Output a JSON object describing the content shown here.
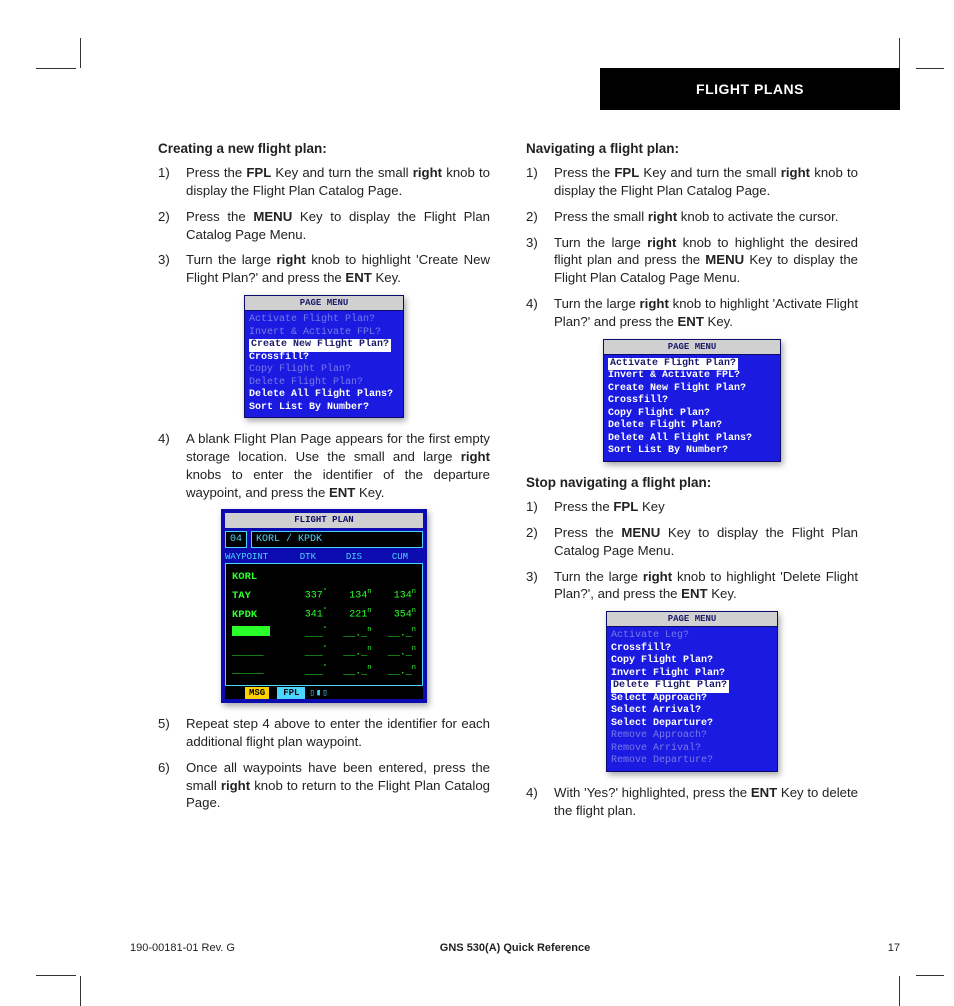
{
  "header": {
    "section": "FLIGHT PLANS"
  },
  "col1": {
    "heading": "Creating a new flight plan:",
    "s1a": "Press the ",
    "s1b": "FPL",
    "s1c": " Key and turn the small ",
    "s1d": "right",
    "s1e": " knob to display the Flight Plan Catalog Page.",
    "s2a": "Press the ",
    "s2b": "MENU",
    "s2c": " Key to display the Flight Plan Catalog Page Menu.",
    "s3a": "Turn the large ",
    "s3b": "right",
    "s3c": " knob to highlight 'Create New Flight Plan?' and press the ",
    "s3d": "ENT",
    "s3e": " Key.",
    "s4a": "A blank Flight Plan Page appears for the first empty storage location.  Use the small and large ",
    "s4b": "right",
    "s4c": " knobs to enter the identifier of the departure waypoint, and press the ",
    "s4d": "ENT",
    "s4e": " Key.",
    "s5": "Repeat step 4 above to enter the identifier for each additional flight plan waypoint.",
    "s6a": "Once all waypoints have been entered, press the small ",
    "s6b": "right",
    "s6c": " knob to return to the Flight Plan Catalog Page."
  },
  "menu1": {
    "title": "PAGE MENU",
    "i1": "Activate Flight Plan?",
    "i2": "Invert & Activate FPL?",
    "i3": "Create New Flight Plan?",
    "i4": "Crossfill?",
    "i5": "Copy Flight Plan?",
    "i6": "Delete Flight Plan?",
    "i7": "Delete All Flight Plans?",
    "i8": "Sort List By Number?"
  },
  "fplan": {
    "title": "FLIGHT PLAN",
    "num": "04",
    "route": "KORL / KPDK",
    "c1": "WAYPOINT",
    "c2": "DTK",
    "c3": "DIS",
    "c4": "CUM",
    "r1w": "KORL",
    "r2w": "TAY",
    "r2a": "337",
    "r2b": "134",
    "r2c": "134",
    "r3w": "KPDK",
    "r3a": "341",
    "r3b": "221",
    "r3c": "354",
    "msg": "MSG",
    "fpl": "FPL"
  },
  "col2": {
    "heading1": "Navigating a flight plan:",
    "n1a": "Press the ",
    "n1b": "FPL",
    "n1c": " Key and turn the small ",
    "n1d": "right",
    "n1e": " knob to display the Flight Plan Catalog Page.",
    "n2a": "Press the small ",
    "n2b": "right",
    "n2c": " knob to activate the cursor.",
    "n3a": "Turn the large ",
    "n3b": "right",
    "n3c": " knob to highlight the desired flight plan and press the ",
    "n3d": "MENU",
    "n3e": " Key to display the Flight Plan Catalog Page Menu.",
    "n4a": "Turn the large ",
    "n4b": "right",
    "n4c": " knob to highlight 'Activate Flight Plan?' and press the ",
    "n4d": "ENT",
    "n4e": " Key.",
    "heading2": "Stop navigating a flight plan:",
    "d1a": "Press the ",
    "d1b": "FPL",
    "d1c": " Key",
    "d2a": "Press the ",
    "d2b": "MENU",
    "d2c": " Key to display the Flight Plan Catalog Page Menu.",
    "d3a": "Turn the large ",
    "d3b": "right",
    "d3c": " knob to highlight 'Delete Flight Plan?', and press the ",
    "d3d": "ENT",
    "d3e": " Key.",
    "d4a": "With 'Yes?' highlighted, press the ",
    "d4b": "ENT",
    "d4c": " Key to delete the flight plan."
  },
  "menu2": {
    "title": "PAGE MENU",
    "i1": "Activate Flight Plan?",
    "i2": "Invert & Activate FPL?",
    "i3": "Create New Flight Plan?",
    "i4": "Crossfill?",
    "i5": "Copy Flight Plan?",
    "i6": "Delete Flight Plan?",
    "i7": "Delete All Flight Plans?",
    "i8": "Sort List By Number?"
  },
  "menu3": {
    "title": "PAGE MENU",
    "i1": "Activate Leg?",
    "i2": "Crossfill?",
    "i3": "Copy Flight Plan?",
    "i4": "Invert Flight Plan?",
    "i5": "Delete Flight Plan?",
    "i6": "Select Approach?",
    "i7": "Select Arrival?",
    "i8": "Select Departure?",
    "i9": "Remove Approach?",
    "i10": "Remove Arrival?",
    "i11": "Remove Departure?"
  },
  "footer": {
    "left": "190-00181-01  Rev. G",
    "mid": "GNS 530(A) Quick Reference",
    "right": "17"
  }
}
